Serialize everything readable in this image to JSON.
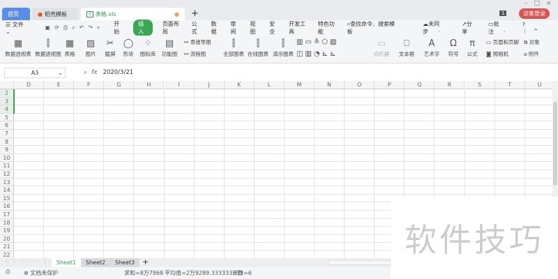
{
  "tabs": [
    {
      "label": "首页"
    },
    {
      "label": "稻壳模板"
    },
    {
      "label": "表格.xls"
    }
  ],
  "tab_badge": "1",
  "login_button": "访客登录",
  "menu": {
    "file": "文件",
    "items": [
      "开始",
      "插入",
      "页面布局",
      "公式",
      "数据",
      "审阅",
      "视图",
      "安全",
      "开发工具",
      "特色功能"
    ],
    "search": "查找命令、搜索模板",
    "sync": "未同步",
    "share": "分享",
    "comment": "批注"
  },
  "ribbon": {
    "pivot_table": "数据透视表",
    "pivot_chart": "数据透视图",
    "table": "表格",
    "picture": "图片",
    "screenshot": "截屏",
    "shape": "形状",
    "icon_lib": "图标库",
    "func_chart": "功能图",
    "mindmap": "思维导图",
    "flowchart": "流程图",
    "all_charts": "全部图表",
    "online_chart": "在线图表",
    "demo_chart": "演示图表",
    "slicer": "切片器",
    "textbox": "文本框",
    "wordart": "艺术字",
    "symbol": "符号",
    "formula": "公式",
    "header_footer": "页眉和页脚",
    "camera": "照相机",
    "object": "对象",
    "attachment": "附件"
  },
  "formula_bar": {
    "cell_ref": "A3",
    "fx": "fx",
    "value": "2020/3/21"
  },
  "columns": [
    "D",
    "E",
    "F",
    "G",
    "H",
    "I",
    "J",
    "K",
    "L",
    "M",
    "N",
    "O",
    "P",
    "Q",
    "R",
    "S",
    "T",
    "U"
  ],
  "rows": [
    "2",
    "3",
    "4",
    "5",
    "6",
    "7",
    "8",
    "9",
    "10",
    "11",
    "12",
    "13",
    "14",
    "15",
    "16",
    "17",
    "18",
    "19",
    "20",
    "21",
    "22"
  ],
  "sheets": [
    "Sheet1",
    "Sheet2",
    "Sheet3"
  ],
  "status": {
    "protect": "文档未保护",
    "sum": "求和=8万7868",
    "avg": "平均值=2万9289.333333333",
    "count": "计数=6"
  },
  "watermark": "软件技巧"
}
